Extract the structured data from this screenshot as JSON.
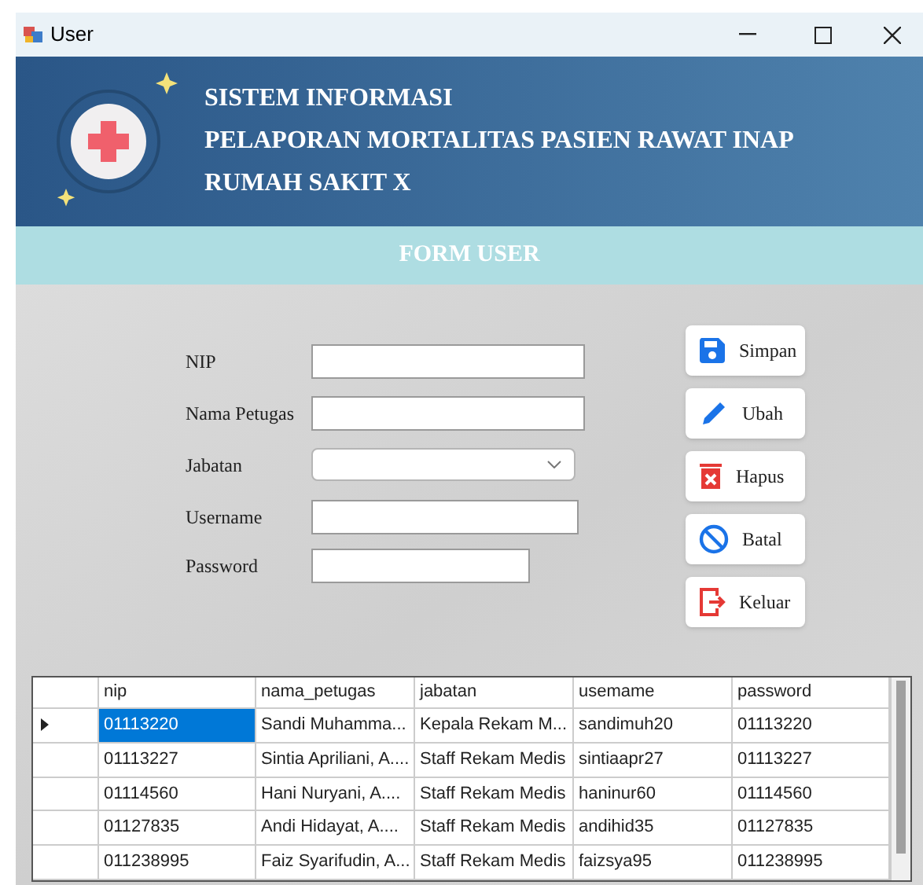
{
  "window": {
    "title": "User"
  },
  "header": {
    "lines": [
      "SISTEM INFORMASI",
      "PELAPORAN MORTALITAS PASIEN RAWAT INAP",
      "RUMAH SAKIT X"
    ]
  },
  "form_title": "FORM USER",
  "fields": [
    {
      "kind": "text",
      "label": "NIP"
    },
    {
      "kind": "text",
      "label": "Nama Petugas"
    },
    {
      "kind": "select",
      "label": "Jabatan"
    },
    {
      "kind": "text",
      "label": "Username"
    },
    {
      "kind": "text",
      "label": "Password"
    }
  ],
  "buttons": [
    {
      "kind": "save",
      "label": "Simpan"
    },
    {
      "kind": "edit",
      "label": "Ubah"
    },
    {
      "kind": "delete",
      "label": "Hapus"
    },
    {
      "kind": "cancel",
      "label": "Batal"
    },
    {
      "kind": "exit",
      "label": "Keluar"
    }
  ],
  "table": {
    "columns": [
      "nip",
      "nama_petugas",
      "jabatan",
      "usemame",
      "password"
    ],
    "rows": [
      {
        "selected": true,
        "cells": [
          "01113220",
          "Sandi Muhamma...",
          "Kepala Rekam M...",
          "sandimuh20",
          "01113220"
        ]
      },
      {
        "selected": false,
        "cells": [
          "01113227",
          "Sintia Apriliani, A....",
          "Staff Rekam Medis",
          "sintiaapr27",
          "01113227"
        ]
      },
      {
        "selected": false,
        "cells": [
          "01114560",
          "Hani Nuryani, A....",
          "Staff Rekam Medis",
          "haninur60",
          "01114560"
        ]
      },
      {
        "selected": false,
        "cells": [
          "01127835",
          "Andi Hidayat, A....",
          "Staff Rekam Medis",
          "andihid35",
          "01127835"
        ]
      },
      {
        "selected": false,
        "cells": [
          "011238995",
          "Faiz Syarifudin, A...",
          "Staff Rekam Medis",
          "faizsya95",
          "011238995"
        ]
      }
    ]
  }
}
